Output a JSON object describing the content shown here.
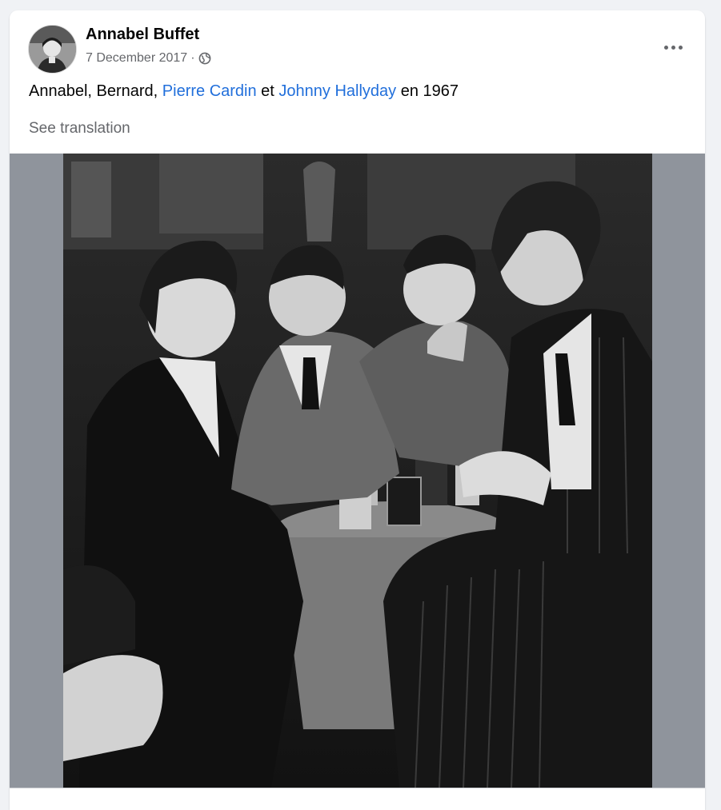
{
  "post": {
    "author": "Annabel Buffet",
    "date": "7 December 2017",
    "separator": "·",
    "audience_icon": "globe-icon",
    "more_icon": "more-options-icon",
    "text_parts": {
      "p1": "Annabel, Bernard, ",
      "tag1": "Pierre Cardin",
      "p2": " et ",
      "tag2": "Johnny Hallyday",
      "p3": " en 1967"
    },
    "see_translation": "See translation",
    "photo_description_icon": "black-and-white-photo"
  },
  "colors": {
    "page_bg": "#f0f2f5",
    "card_bg": "#ffffff",
    "link": "#216fdb",
    "secondary_text": "#65676b",
    "media_bg": "#8f949c"
  }
}
